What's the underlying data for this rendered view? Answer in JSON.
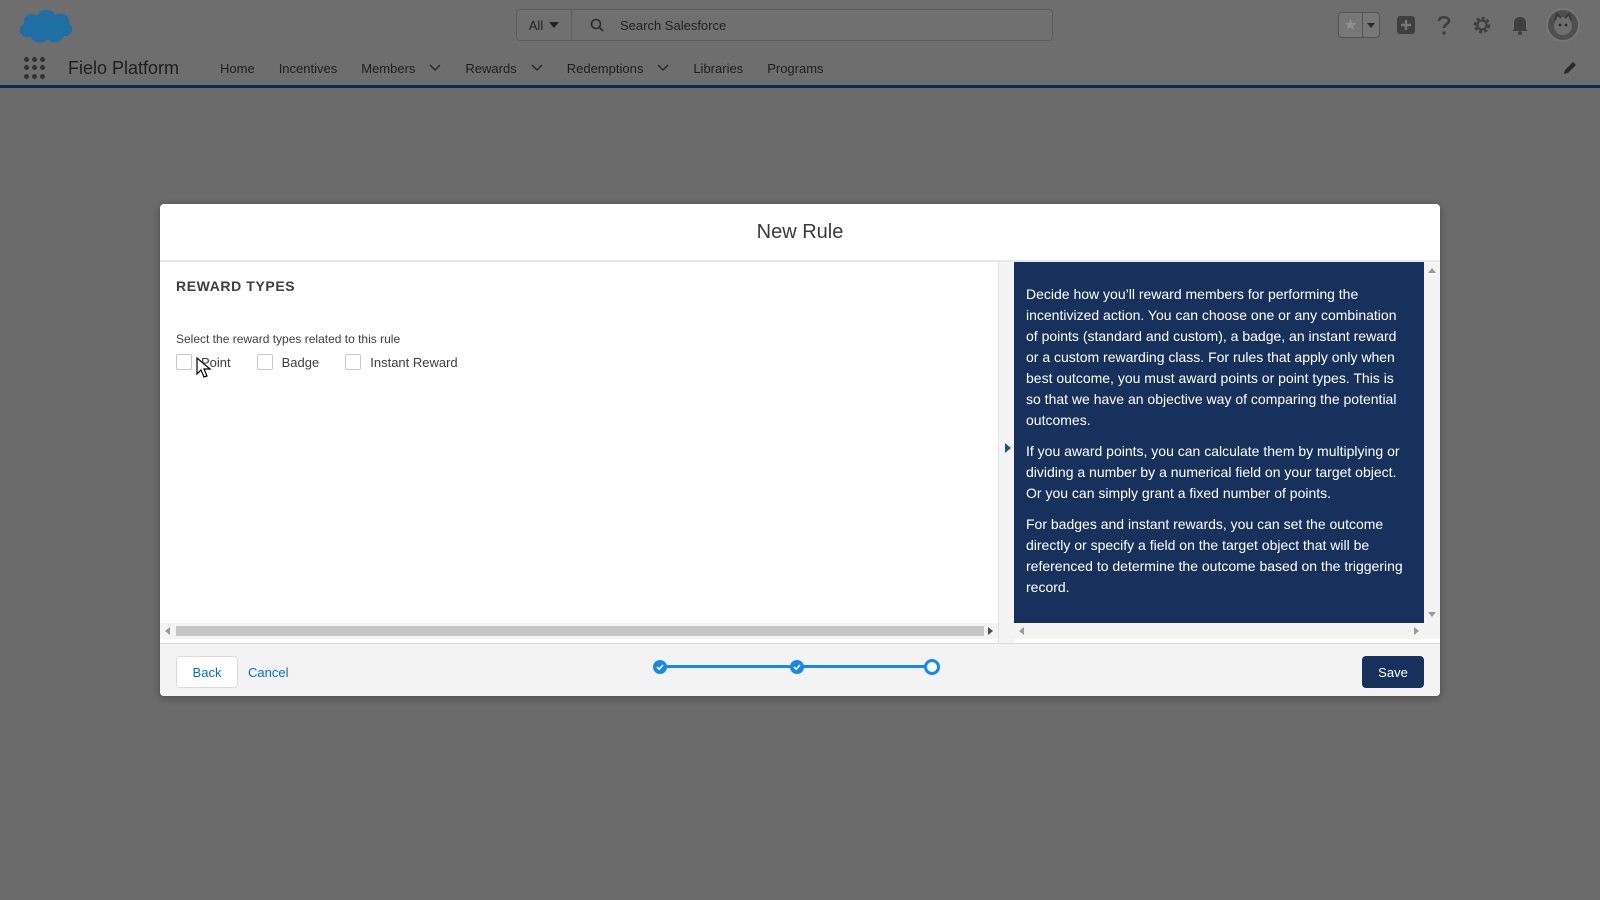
{
  "header": {
    "search_scope": "All",
    "search_placeholder": "Search Salesforce"
  },
  "nav": {
    "app_name": "Fielo Platform",
    "items": [
      {
        "label": "Home",
        "has_menu": false
      },
      {
        "label": "Incentives",
        "has_menu": false
      },
      {
        "label": "Members",
        "has_menu": true
      },
      {
        "label": "Rewards",
        "has_menu": true
      },
      {
        "label": "Redemptions",
        "has_menu": true
      },
      {
        "label": "Libraries",
        "has_menu": false
      },
      {
        "label": "Programs",
        "has_menu": false
      }
    ]
  },
  "modal": {
    "title": "New Rule",
    "section_title": "REWARD TYPES",
    "help_text": "Select the reward types related to this rule",
    "reward_types": [
      {
        "label": "Point",
        "checked": false
      },
      {
        "label": "Badge",
        "checked": false
      },
      {
        "label": "Instant Reward",
        "checked": false
      }
    ],
    "guidance": [
      "Decide how you’ll reward members for performing the incentivized action. You can choose one or any combination of points (standard and custom), a badge, an instant reward or a custom rewarding class. For rules that apply only when best outcome, you must award points or point types. This is so that we have an objective way of comparing the potential outcomes.",
      "If you award points, you can calculate them by multiplying or dividing a number by a numerical field on your target object. Or you can simply grant a fixed number of points.",
      "For badges and instant rewards, you can set the outcome directly or specify a field on the target object that will be referenced to determine the outcome based on the triggering record."
    ],
    "footer": {
      "back_label": "Back",
      "cancel_label": "Cancel",
      "save_label": "Save",
      "steps_total": 3,
      "current_step": 3
    }
  },
  "colors": {
    "brand_dark": "#16325c",
    "accent": "#1589ee",
    "link": "#0070d2",
    "overlay_bg": "#6b6b6b"
  },
  "icons": [
    "salesforce-cloud-logo",
    "search-icon",
    "star-icon",
    "add-icon",
    "help-icon",
    "setup-gear-icon",
    "notification-bell-icon",
    "user-avatar-icon",
    "app-launcher-icon",
    "chevron-down-icon",
    "edit-pencil-icon",
    "check-icon",
    "cursor-arrow-icon"
  ]
}
